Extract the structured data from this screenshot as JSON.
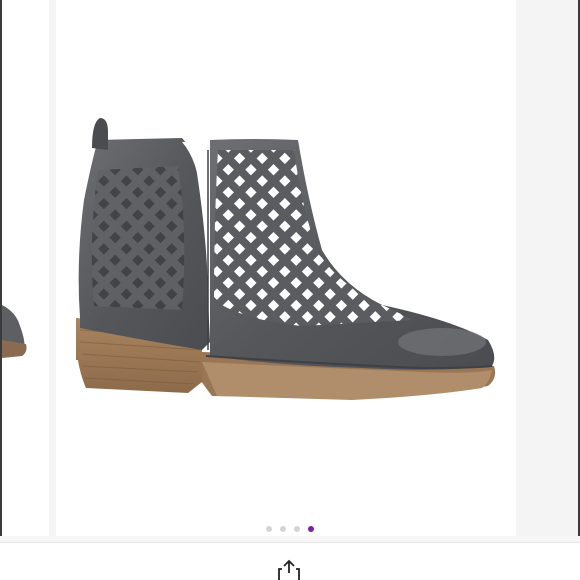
{
  "carousel": {
    "slide_count": 4,
    "active_index": 3,
    "accent_color": "#7a1fa2",
    "inactive_dot_color": "#d4d4d4",
    "image": {
      "subject": "grey-laser-cut-ankle-bootie"
    }
  },
  "actions": {
    "share_icon": "share-icon"
  }
}
